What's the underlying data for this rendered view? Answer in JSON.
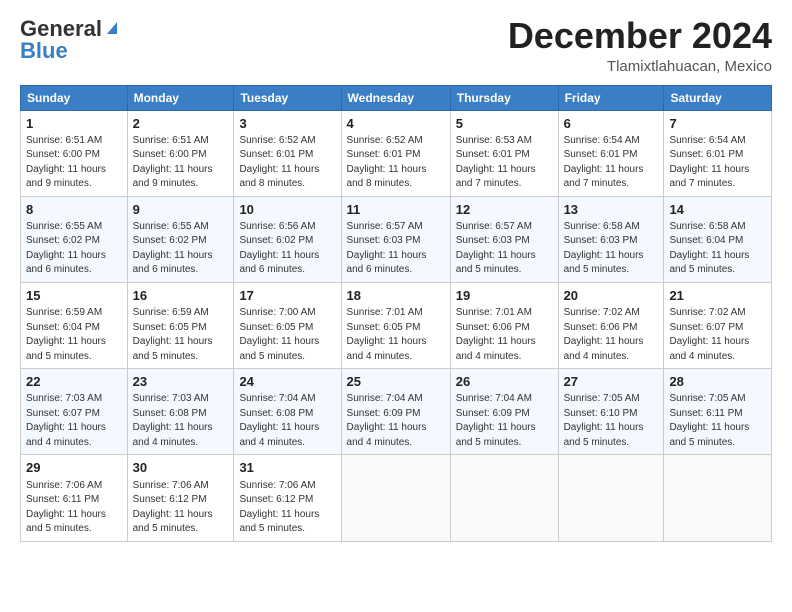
{
  "header": {
    "logo_line1": "General",
    "logo_line2": "Blue",
    "month": "December 2024",
    "location": "Tlamixtlahuacan, Mexico"
  },
  "days_of_week": [
    "Sunday",
    "Monday",
    "Tuesday",
    "Wednesday",
    "Thursday",
    "Friday",
    "Saturday"
  ],
  "weeks": [
    [
      {
        "day": 1,
        "info": "Sunrise: 6:51 AM\nSunset: 6:00 PM\nDaylight: 11 hours\nand 9 minutes."
      },
      {
        "day": 2,
        "info": "Sunrise: 6:51 AM\nSunset: 6:00 PM\nDaylight: 11 hours\nand 9 minutes."
      },
      {
        "day": 3,
        "info": "Sunrise: 6:52 AM\nSunset: 6:01 PM\nDaylight: 11 hours\nand 8 minutes."
      },
      {
        "day": 4,
        "info": "Sunrise: 6:52 AM\nSunset: 6:01 PM\nDaylight: 11 hours\nand 8 minutes."
      },
      {
        "day": 5,
        "info": "Sunrise: 6:53 AM\nSunset: 6:01 PM\nDaylight: 11 hours\nand 7 minutes."
      },
      {
        "day": 6,
        "info": "Sunrise: 6:54 AM\nSunset: 6:01 PM\nDaylight: 11 hours\nand 7 minutes."
      },
      {
        "day": 7,
        "info": "Sunrise: 6:54 AM\nSunset: 6:01 PM\nDaylight: 11 hours\nand 7 minutes."
      }
    ],
    [
      {
        "day": 8,
        "info": "Sunrise: 6:55 AM\nSunset: 6:02 PM\nDaylight: 11 hours\nand 6 minutes."
      },
      {
        "day": 9,
        "info": "Sunrise: 6:55 AM\nSunset: 6:02 PM\nDaylight: 11 hours\nand 6 minutes."
      },
      {
        "day": 10,
        "info": "Sunrise: 6:56 AM\nSunset: 6:02 PM\nDaylight: 11 hours\nand 6 minutes."
      },
      {
        "day": 11,
        "info": "Sunrise: 6:57 AM\nSunset: 6:03 PM\nDaylight: 11 hours\nand 6 minutes."
      },
      {
        "day": 12,
        "info": "Sunrise: 6:57 AM\nSunset: 6:03 PM\nDaylight: 11 hours\nand 5 minutes."
      },
      {
        "day": 13,
        "info": "Sunrise: 6:58 AM\nSunset: 6:03 PM\nDaylight: 11 hours\nand 5 minutes."
      },
      {
        "day": 14,
        "info": "Sunrise: 6:58 AM\nSunset: 6:04 PM\nDaylight: 11 hours\nand 5 minutes."
      }
    ],
    [
      {
        "day": 15,
        "info": "Sunrise: 6:59 AM\nSunset: 6:04 PM\nDaylight: 11 hours\nand 5 minutes."
      },
      {
        "day": 16,
        "info": "Sunrise: 6:59 AM\nSunset: 6:05 PM\nDaylight: 11 hours\nand 5 minutes."
      },
      {
        "day": 17,
        "info": "Sunrise: 7:00 AM\nSunset: 6:05 PM\nDaylight: 11 hours\nand 5 minutes."
      },
      {
        "day": 18,
        "info": "Sunrise: 7:01 AM\nSunset: 6:05 PM\nDaylight: 11 hours\nand 4 minutes."
      },
      {
        "day": 19,
        "info": "Sunrise: 7:01 AM\nSunset: 6:06 PM\nDaylight: 11 hours\nand 4 minutes."
      },
      {
        "day": 20,
        "info": "Sunrise: 7:02 AM\nSunset: 6:06 PM\nDaylight: 11 hours\nand 4 minutes."
      },
      {
        "day": 21,
        "info": "Sunrise: 7:02 AM\nSunset: 6:07 PM\nDaylight: 11 hours\nand 4 minutes."
      }
    ],
    [
      {
        "day": 22,
        "info": "Sunrise: 7:03 AM\nSunset: 6:07 PM\nDaylight: 11 hours\nand 4 minutes."
      },
      {
        "day": 23,
        "info": "Sunrise: 7:03 AM\nSunset: 6:08 PM\nDaylight: 11 hours\nand 4 minutes."
      },
      {
        "day": 24,
        "info": "Sunrise: 7:04 AM\nSunset: 6:08 PM\nDaylight: 11 hours\nand 4 minutes."
      },
      {
        "day": 25,
        "info": "Sunrise: 7:04 AM\nSunset: 6:09 PM\nDaylight: 11 hours\nand 4 minutes."
      },
      {
        "day": 26,
        "info": "Sunrise: 7:04 AM\nSunset: 6:09 PM\nDaylight: 11 hours\nand 5 minutes."
      },
      {
        "day": 27,
        "info": "Sunrise: 7:05 AM\nSunset: 6:10 PM\nDaylight: 11 hours\nand 5 minutes."
      },
      {
        "day": 28,
        "info": "Sunrise: 7:05 AM\nSunset: 6:11 PM\nDaylight: 11 hours\nand 5 minutes."
      }
    ],
    [
      {
        "day": 29,
        "info": "Sunrise: 7:06 AM\nSunset: 6:11 PM\nDaylight: 11 hours\nand 5 minutes."
      },
      {
        "day": 30,
        "info": "Sunrise: 7:06 AM\nSunset: 6:12 PM\nDaylight: 11 hours\nand 5 minutes."
      },
      {
        "day": 31,
        "info": "Sunrise: 7:06 AM\nSunset: 6:12 PM\nDaylight: 11 hours\nand 5 minutes."
      },
      null,
      null,
      null,
      null
    ]
  ]
}
